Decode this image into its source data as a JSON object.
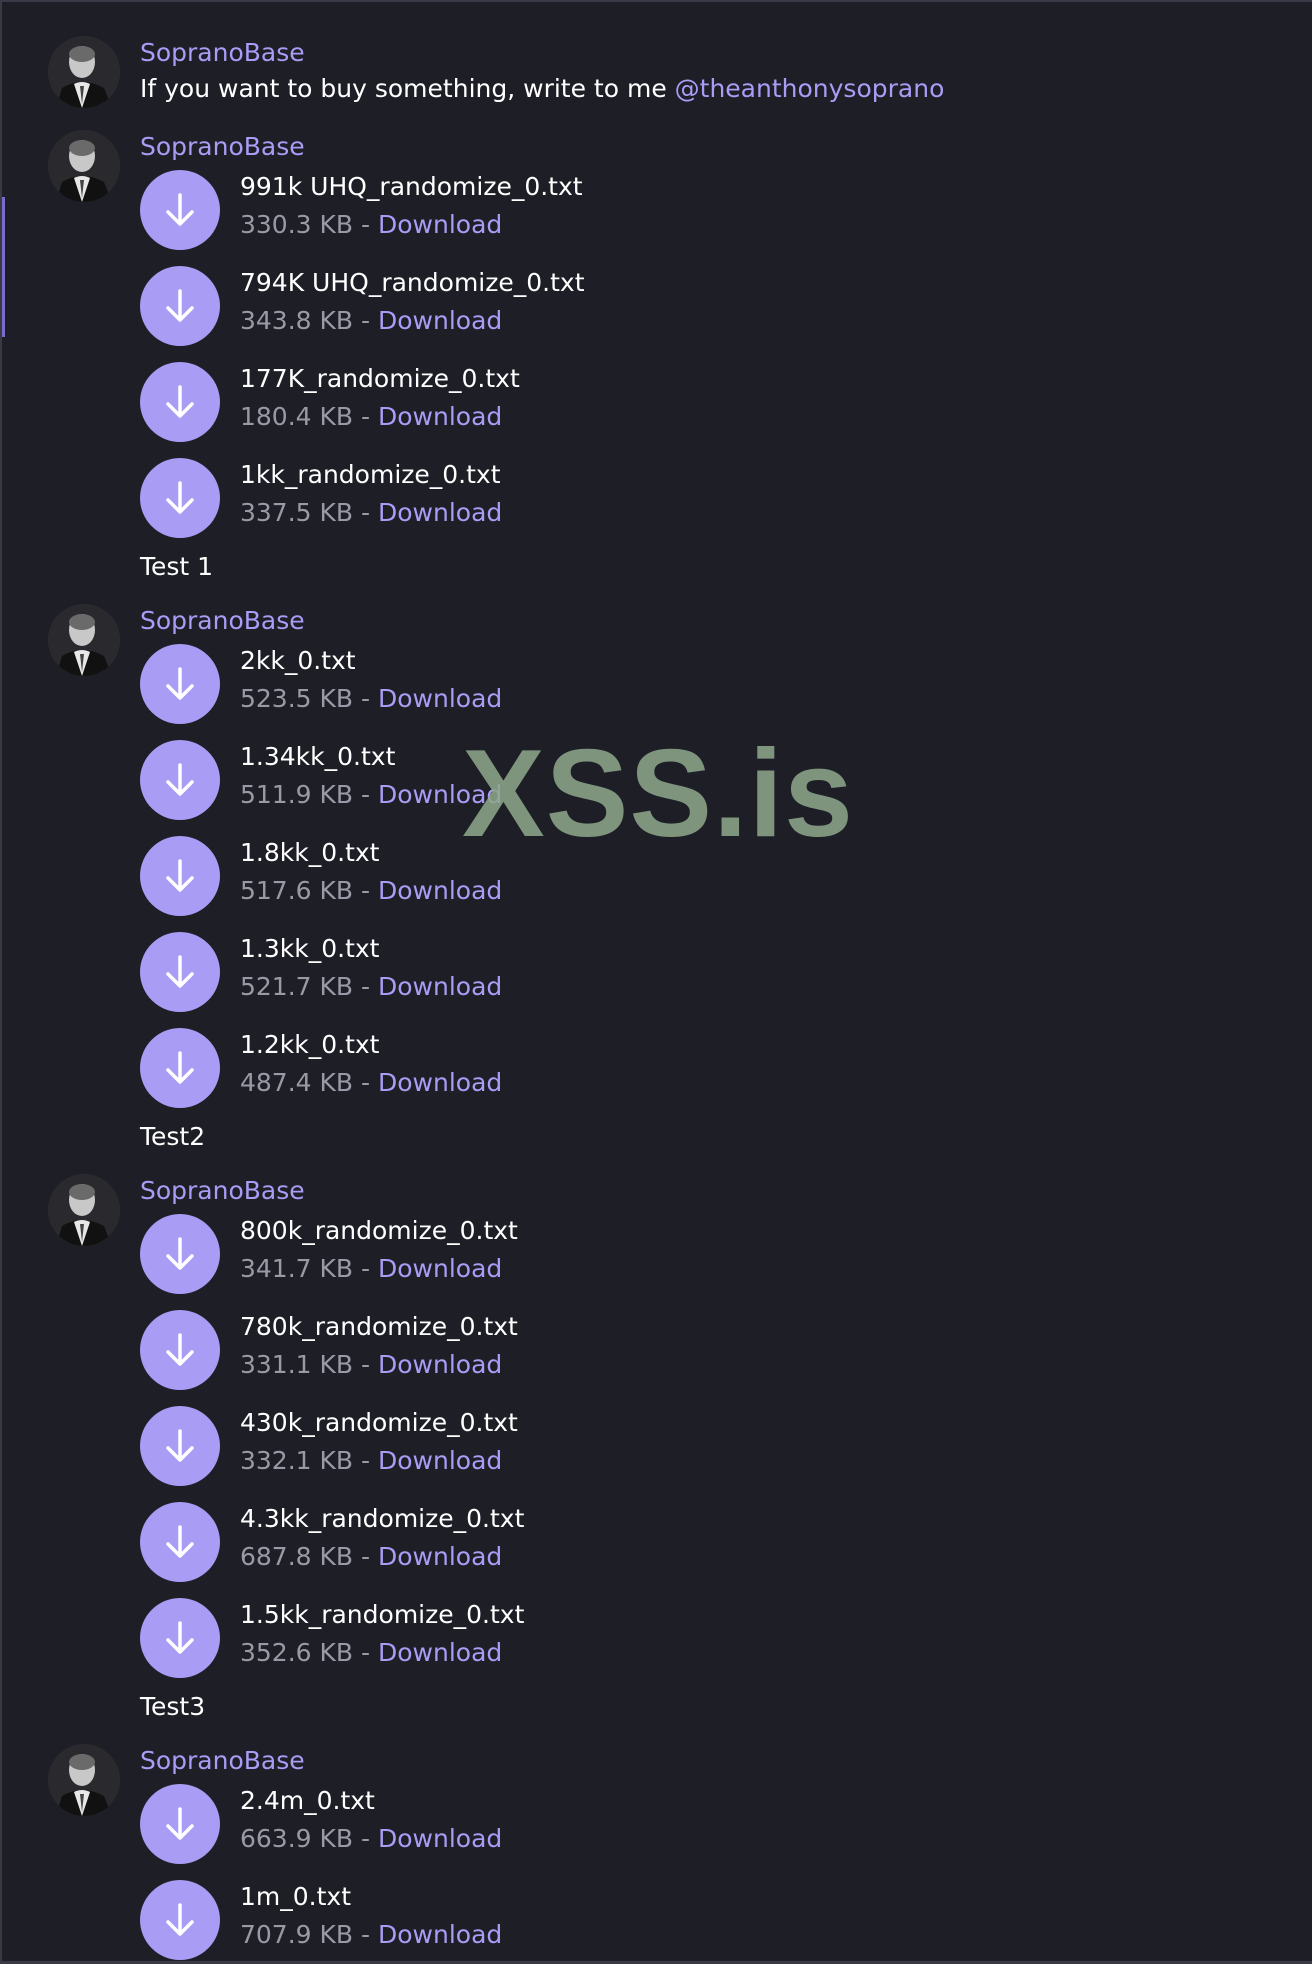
{
  "colors": {
    "background": "#1e1e27",
    "accent": "#a99cf5",
    "muted": "#9a9aa6",
    "watermark": "#8fa98b"
  },
  "watermark": "XSS.is",
  "messages": [
    {
      "sender": "SopranoBase",
      "text_prefix": "If you want to buy something, write to me ",
      "mention": "@theanthonysoprano"
    },
    {
      "sender": "SopranoBase",
      "files": [
        {
          "name": "991k UHQ_randomize_0.txt",
          "size": "330.3 KB"
        },
        {
          "name": "794K UHQ_randomize_0.txt",
          "size": "343.8 KB"
        },
        {
          "name": "177K_randomize_0.txt",
          "size": "180.4 KB"
        },
        {
          "name": "1kk_randomize_0.txt",
          "size": "337.5 KB"
        }
      ],
      "caption": "Test 1"
    },
    {
      "sender": "SopranoBase",
      "files": [
        {
          "name": "2kk_0.txt",
          "size": "523.5 KB"
        },
        {
          "name": "1.34kk_0.txt",
          "size": "511.9 KB"
        },
        {
          "name": "1.8kk_0.txt",
          "size": "517.6 KB"
        },
        {
          "name": "1.3kk_0.txt",
          "size": "521.7 KB"
        },
        {
          "name": "1.2kk_0.txt",
          "size": "487.4 KB"
        }
      ],
      "caption": "Test2"
    },
    {
      "sender": "SopranoBase",
      "files": [
        {
          "name": "800k_randomize_0.txt",
          "size": "341.7 KB"
        },
        {
          "name": "780k_randomize_0.txt",
          "size": "331.1 KB"
        },
        {
          "name": "430k_randomize_0.txt",
          "size": "332.1 KB"
        },
        {
          "name": "4.3kk_randomize_0.txt",
          "size": "687.8 KB"
        },
        {
          "name": "1.5kk_randomize_0.txt",
          "size": "352.6 KB"
        }
      ],
      "caption": "Test3"
    },
    {
      "sender": "SopranoBase",
      "files": [
        {
          "name": "2.4m_0.txt",
          "size": "663.9 KB"
        },
        {
          "name": "1m_0.txt",
          "size": "707.9 KB"
        }
      ]
    }
  ],
  "labels": {
    "separator": " - ",
    "download": "Download"
  },
  "icons": {
    "avatar": "avatar-portrait",
    "file_button": "download-arrow-icon"
  }
}
